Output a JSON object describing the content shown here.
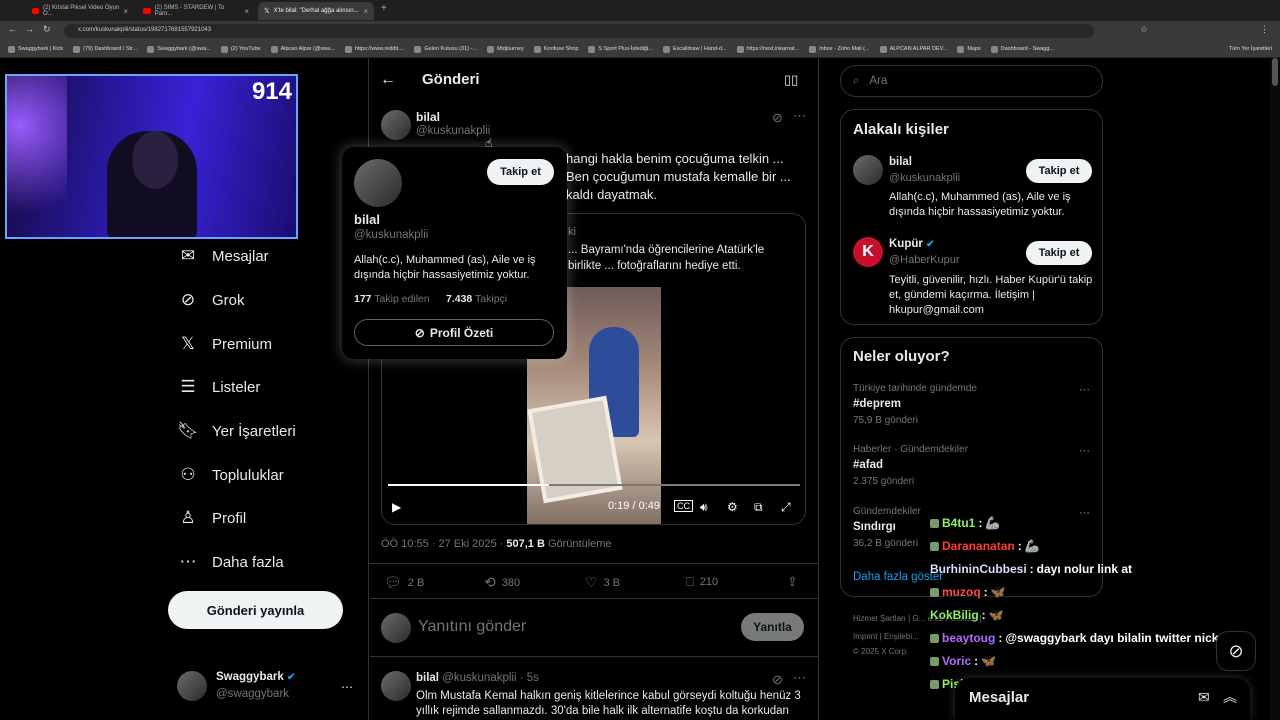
{
  "browser": {
    "tabs": [
      {
        "title": "(2) Kristal Piksel Video Oyun O..."
      },
      {
        "title": "(2) SIMS - STARDEW | To Paro..."
      },
      {
        "title": "X'te bilal: \"Derhal ağğa alınsın..."
      }
    ],
    "url": "x.com/kuskunakplii/status/1982717681557921043",
    "bookmarks": [
      "Swaggybark | Kick",
      "(79) Dashboard / Str...",
      "Swaggybark (@swa...",
      "(2) YouTube",
      "Alpcan Alpar (@swa...",
      "https://www.reddit....",
      "Gelen Kutusu (31) -...",
      "Midjourney",
      "Konfuse Shop",
      "S Sport Plus-İstediği...",
      "Excalidraw | Hand-d...",
      "https://next.inkarnat...",
      "Inbox - Zoho Mail (...",
      "ALPCAN ALPAR DEV...",
      "Maps",
      "Dashboard - Swagg..."
    ],
    "bookmarks_right": "Tüm Yer İşaretleri"
  },
  "webcam": {
    "count": "914"
  },
  "sidebar": {
    "items": [
      {
        "label": "Mesajlar",
        "icon": "mail-icon"
      },
      {
        "label": "Grok",
        "icon": "grok-icon"
      },
      {
        "label": "Premium",
        "icon": "x-logo-icon"
      },
      {
        "label": "Listeler",
        "icon": "list-icon"
      },
      {
        "label": "Yer İşaretleri",
        "icon": "bookmark-icon"
      },
      {
        "label": "Topluluklar",
        "icon": "communities-icon"
      },
      {
        "label": "Profil",
        "icon": "profile-icon"
      },
      {
        "label": "Daha fazla",
        "icon": "more-icon"
      }
    ],
    "post_button": "Gönderi yayınla",
    "account": {
      "name": "Swaggybark",
      "handle": "@swaggybark"
    }
  },
  "main": {
    "header_title": "Gönderi",
    "author": {
      "name": "bilal",
      "handle": "@kuskunakplii"
    },
    "tweet_text": "hangi hakla benim çocuğuma telkin ... Ben çocuğumun mustafa kemalle bir ... kaldı dayatmak.",
    "quote_text": "... Bayramı'nda öğrencilerine Atatürk'le birlikte ... fotoğraflarını hediye etti.",
    "quote_header_fragment": "ki",
    "video_time": "0:19 / 0:49",
    "video_progress": 0.39,
    "timestamp": "ÖÖ 10:55 · 27 Eki 2025 · ",
    "views": "507,1 B",
    "views_label": "Görüntüleme",
    "stats": {
      "replies": "2 B",
      "reposts": "380",
      "likes": "3 B",
      "bookmarks": "210"
    },
    "reply_placeholder": "Yanıtını gönder",
    "reply_button": "Yanıtla",
    "reply": {
      "name": "bilal",
      "handle": "@kuskunakplii",
      "time": "· 5s",
      "text_line1": "Olm Mustafa Kemal halkın geniş kitlelerince kabul görseydi koltuğu henüz 3",
      "text_line2": "yıllık rejimde sallanmazdı. 30'da bile halk ilk alternatife koştu da korkudan"
    }
  },
  "popover": {
    "follow_button": "Takip et",
    "name": "bilal",
    "handle": "@kuskunakplii",
    "bio": "Allah(c.c), Muhammed (as), Aile ve iş dışında hiçbir hassasiyetimiz yoktur.",
    "following_count": "177",
    "following_label": "Takip edilen",
    "followers_count": "7.438",
    "followers_label": "Takipçi",
    "summary_button": "Profil Özeti"
  },
  "right": {
    "search_placeholder": "Ara",
    "related_title": "Alakalı kişiler",
    "related": [
      {
        "name": "bilal",
        "handle": "@kuskunakplii",
        "bio": "Allah(c.c), Muhammed (as), Aile ve iş dışında hiçbir hassasiyetimiz yoktur.",
        "follow": "Takip et"
      },
      {
        "name": "Kupür",
        "handle": "@HaberKupur",
        "bio": "Teyitli, güvenilir, hızlı. Haber Kupür'ü takip et, gündemi kaçırma. İletişim | hkupur@gmail.com",
        "follow": "Takip et"
      }
    ],
    "trending_title": "Neler oluyor?",
    "trends": [
      {
        "category": "Türkiye tarihinde gündemde",
        "name": "#deprem",
        "count": "75,9 B gönderi"
      },
      {
        "category": "Haberler · Gündemdekiler",
        "name": "#afad",
        "count": "2.375 gönderi"
      },
      {
        "category": "Gündemdekiler",
        "name": "Sındırgı",
        "count": "36,2 B gönderi"
      }
    ],
    "show_more": "Daha fazla göster",
    "footer_line1": "Hizmet Şartları  |  G...                      erez Politikası  |",
    "footer_line2": "Imprint  |  Erişilebi...",
    "footer_line3": "© 2025 X Corp."
  },
  "chat": [
    {
      "user": "B4tu1",
      "color": "#8fef6a",
      "message": ""
    },
    {
      "user": "Darananatan",
      "color": "#ff3b3b",
      "message": ""
    },
    {
      "user": "BurhininCubbesi",
      "color": "#dcdcff",
      "message": "dayı nolur link at"
    },
    {
      "user": "muzoq",
      "color": "#ff4a4a",
      "message": ""
    },
    {
      "user": "KokBilig",
      "color": "#8fef6a",
      "message": ""
    },
    {
      "user": "beaytoug",
      "color": "#b36bff",
      "message": "@swaggybark dayı bilalin twitter nick bak"
    },
    {
      "user": "Voric",
      "color": "#b36bff",
      "message": ""
    },
    {
      "user": "Piskevilt",
      "color": "#8fef6a",
      "message": ""
    }
  ],
  "messages_bar": {
    "label": "Mesajlar"
  }
}
